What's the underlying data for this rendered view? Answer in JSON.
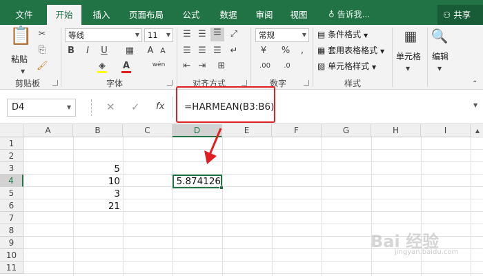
{
  "tabs": [
    {
      "label": "文件",
      "active": false
    },
    {
      "label": "开始",
      "active": true
    },
    {
      "label": "插入",
      "active": false
    },
    {
      "label": "页面布局",
      "active": false
    },
    {
      "label": "公式",
      "active": false
    },
    {
      "label": "数据",
      "active": false
    },
    {
      "label": "审阅",
      "active": false
    },
    {
      "label": "视图",
      "active": false
    }
  ],
  "tell_me": "告诉我...",
  "share": "共享",
  "ribbon": {
    "clipboard": {
      "paste": "粘贴",
      "label": "剪贴板"
    },
    "font": {
      "name": "等线",
      "size": "11",
      "label": "字体",
      "bold": "B",
      "italic": "I",
      "underline": "U",
      "phonetic": "wén"
    },
    "alignment": {
      "label": "对齐方式"
    },
    "number": {
      "format": "常规",
      "label": "数字"
    },
    "styles": {
      "conditional": "条件格式",
      "table": "套用表格格式",
      "cell_styles": "单元格样式",
      "label": "样式"
    },
    "cells": {
      "label": "单元格"
    },
    "editing": {
      "label": "编辑"
    }
  },
  "formula_bar": {
    "name_box": "D4",
    "formula": "=HARMEAN(B3:B6)"
  },
  "columns": [
    "A",
    "B",
    "C",
    "D",
    "E",
    "F",
    "G",
    "H",
    "I"
  ],
  "rows": [
    "1",
    "2",
    "3",
    "4",
    "5",
    "6",
    "7",
    "8",
    "9",
    "10",
    "11"
  ],
  "cells": {
    "B3": "5",
    "B4": "10",
    "B5": "3",
    "B6": "21",
    "D4": "5.874126"
  },
  "colors": {
    "accent": "#217346",
    "highlight": "#e02020"
  }
}
